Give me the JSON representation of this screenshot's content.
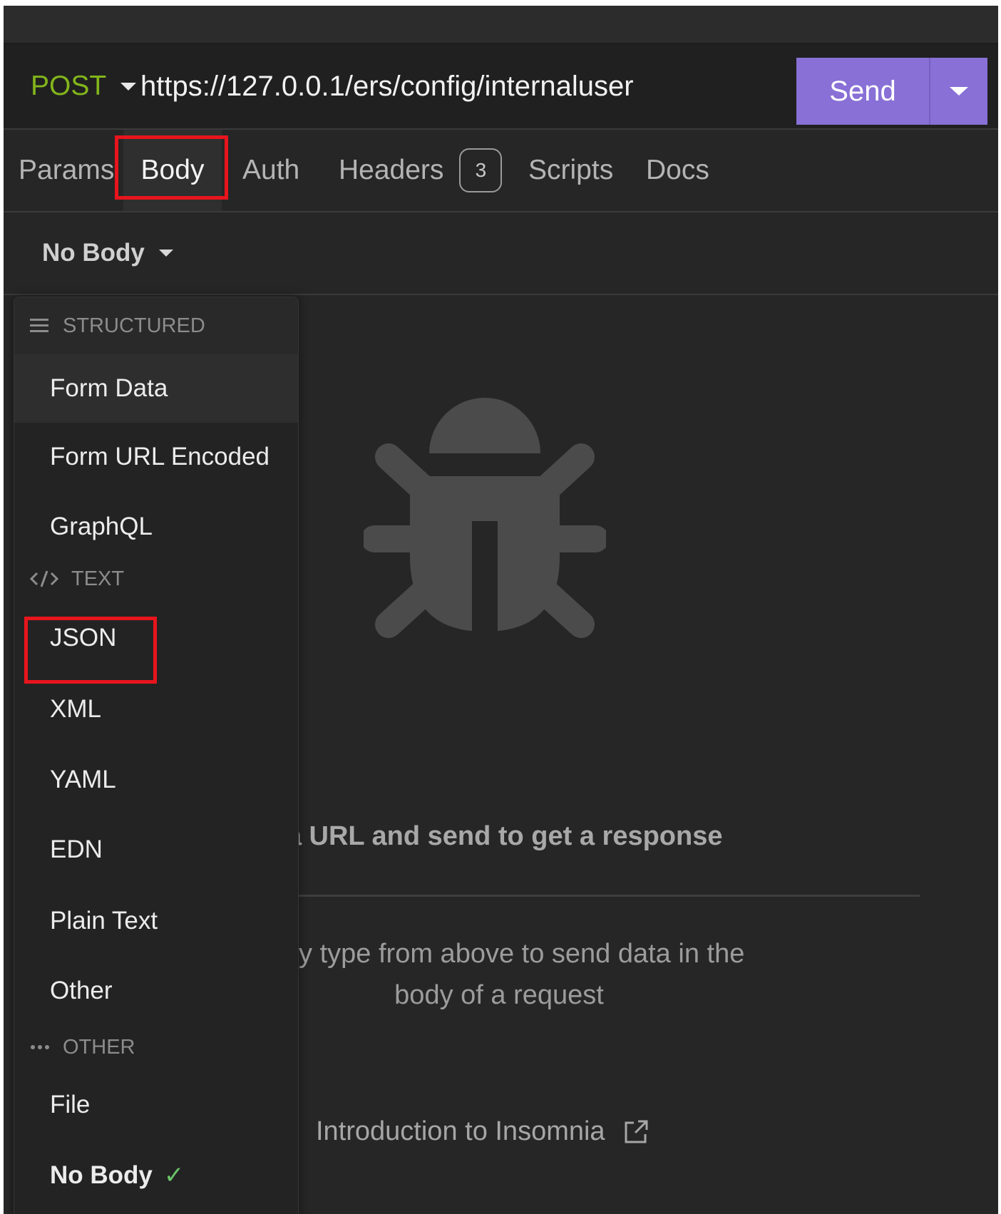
{
  "request": {
    "method": "POST",
    "url": "https://127.0.0.1/ers/config/internaluser"
  },
  "send": {
    "label": "Send"
  },
  "tabs": [
    {
      "label": "Params"
    },
    {
      "label": "Body"
    },
    {
      "label": "Auth"
    },
    {
      "label": "Headers",
      "count": "3"
    },
    {
      "label": "Scripts"
    },
    {
      "label": "Docs"
    }
  ],
  "body_type": {
    "label": "No Body"
  },
  "dropdown": {
    "sections": [
      {
        "label": "STRUCTURED",
        "icon": "list-icon"
      },
      {
        "label": "TEXT",
        "icon": "code-icon"
      },
      {
        "label": "OTHER",
        "icon": "ellipsis-icon"
      }
    ],
    "items": [
      {
        "label": "Form Data"
      },
      {
        "label": "Form URL Encoded"
      },
      {
        "label": "GraphQL"
      },
      {
        "label": "JSON"
      },
      {
        "label": "XML"
      },
      {
        "label": "YAML"
      },
      {
        "label": "EDN"
      },
      {
        "label": "Plain Text"
      },
      {
        "label": "Other"
      },
      {
        "label": "File"
      },
      {
        "label": "No Body",
        "checked": true
      }
    ]
  },
  "empty_state": {
    "title": "r a URL and send to get a response",
    "description": "body type from above to send data in the body of a request",
    "link": "Introduction to Insomnia"
  },
  "colors": {
    "method": "#82b51b",
    "send_button": "#8870d6",
    "highlight_box": "#e8151c",
    "check": "#6ac46a"
  }
}
